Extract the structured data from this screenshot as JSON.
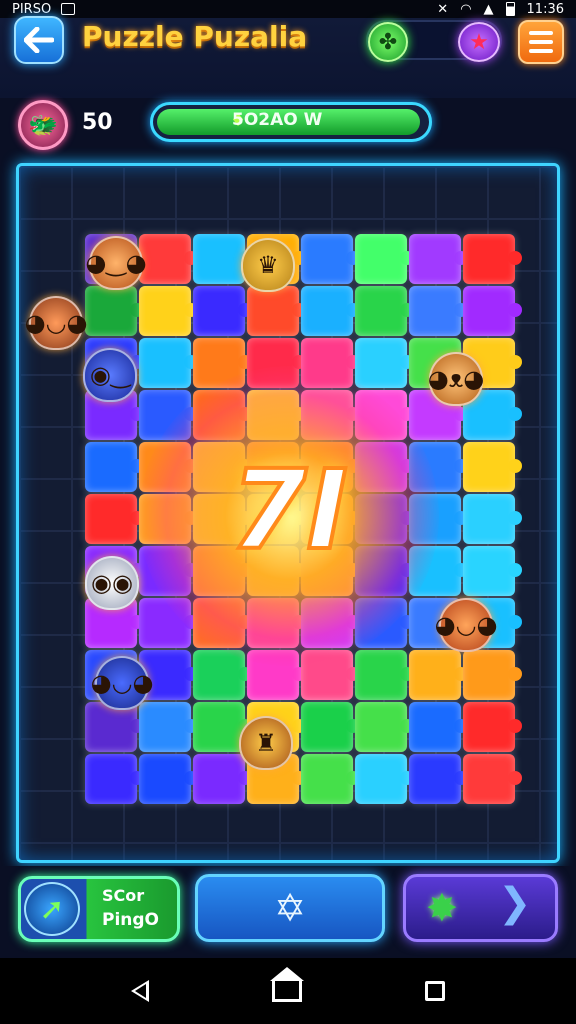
{
  "status_bar": {
    "carrier": "PIRSO",
    "time": "11:36"
  },
  "header": {
    "title": "Puzzle Puzalia",
    "toggle_left_icon": "clover-icon",
    "toggle_right_icon": "star-icon"
  },
  "stats": {
    "score": "50",
    "progress_text": "5O2AO W",
    "progress_fraction": 0.98
  },
  "board": {
    "center_number": "7I",
    "pieces": [
      "#5a2ad0",
      "#ff3a3a",
      "#19c0ff",
      "#ffb000",
      "#2a7bff",
      "#43ff6a",
      "#a13aff",
      "#ff2a2a",
      "#1aa83a",
      "#ffd21a",
      "#3a2aff",
      "#ff4a2a",
      "#1ab0ff",
      "#29d44a",
      "#3a7bff",
      "#a12aff",
      "#2a3aff",
      "#19c0ff",
      "#ff7a1a",
      "#ff2a4a",
      "#ff3a8a",
      "#2ad0ff",
      "#45e04a",
      "#ffcc1a",
      "#7a2aff",
      "#2a5aff",
      "#ff6a1a",
      "#ffe01a",
      "#ff5aa0",
      "#ff4ad8",
      "#c43aff",
      "#19c0ff",
      "#1a6bff",
      "#ff8a1a",
      "#ffd21a",
      "#ff9a1a",
      "#ff7a1a",
      "#c43aff",
      "#2a7bff",
      "#ffd21a",
      "#ff2a2a",
      "#ffa01a",
      "#ffe01a",
      "#ffe81a",
      "#ffa01a",
      "#5a2aff",
      "#19a0ff",
      "#2ad0ff",
      "#8a2aff",
      "#7a2aff",
      "#ff9a1a",
      "#ffd21a",
      "#ffb01a",
      "#3a2aff",
      "#19c0ff",
      "#29d4ff",
      "#b62aff",
      "#8a2aff",
      "#ff6a2a",
      "#ff4a9a",
      "#d03aff",
      "#2a5aff",
      "#3a7bff",
      "#19c0ff",
      "#2a4aff",
      "#3a2aff",
      "#1ad05a",
      "#ff3ac8",
      "#ff4a8a",
      "#29d44a",
      "#ffb01a",
      "#ff9a1a",
      "#5a2ad0",
      "#2a8bff",
      "#29d44a",
      "#ffd21a",
      "#1ad04a",
      "#45e04a",
      "#1a6bff",
      "#ff2a2a",
      "#3a2aff",
      "#1a4aff",
      "#7a2aff",
      "#ffb01a",
      "#45e04a",
      "#2ad0ff",
      "#2a3aff",
      "#ff3a3a"
    ]
  },
  "booster": {
    "line1": "SCor",
    "line2": "PingO",
    "icon": "arrow-icon"
  },
  "center_button": {
    "icon": "star-outline-icon",
    "glyph": "✡"
  },
  "next_button": {
    "icon": "next-arrow-icon",
    "star_glyph": "✸",
    "arrow_glyph": "❯"
  }
}
